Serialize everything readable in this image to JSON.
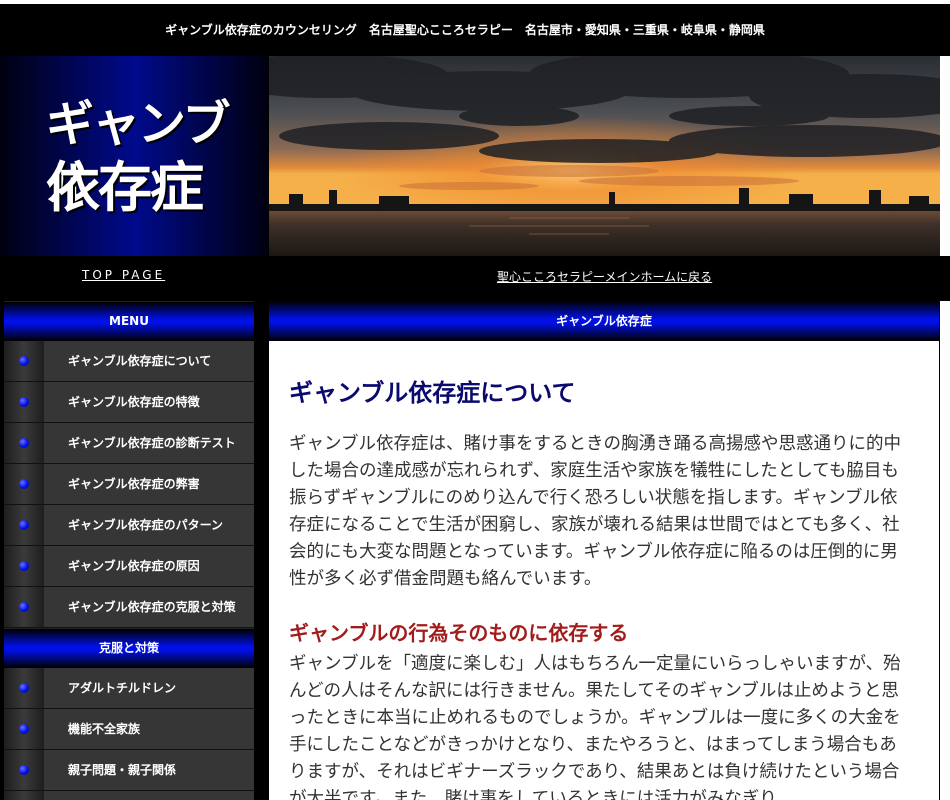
{
  "header": {
    "title": "ギャンブル依存症のカウンセリング　名古屋聖心こころセラピー　名古屋市・愛知県・三重県・岐阜県・静岡県"
  },
  "logo": {
    "line1": "ギャンブル",
    "line2": "依存症"
  },
  "nav": {
    "top_page": "TOP PAGE",
    "main_home": "聖心こころセラピーメインホームに戻る"
  },
  "sidebar": {
    "menu_heading": "MENU",
    "menu_items": [
      {
        "label": "ギャンブル依存症について"
      },
      {
        "label": "ギャンブル依存症の特徴"
      },
      {
        "label": "ギャンブル依存症の診断テスト"
      },
      {
        "label": "ギャンブル依存症の弊害"
      },
      {
        "label": "ギャンブル依存症のパターン"
      },
      {
        "label": "ギャンブル依存症の原因"
      },
      {
        "label": "ギャンブル依存症の克服と対策"
      }
    ],
    "section2_heading": "克服と対策",
    "section2_items": [
      {
        "label": "アダルトチルドレン"
      },
      {
        "label": "機能不全家族"
      },
      {
        "label": "親子問題・親子関係"
      }
    ]
  },
  "main": {
    "heading_bar": "ギャンブル依存症",
    "h1": "ギャンブル依存症について",
    "p1": "ギャンブル依存症は、賭け事をするときの胸湧き踊る高揚感や思惑通りに的中した場合の達成感が忘れられず、家庭生活や家族を犠牲にしたとしても脇目も振らずギャンブルにのめり込んで行く恐ろしい状態を指します。ギャンブル依存症になることで生活が困窮し、家族が壊れる結果は世間ではとても多く、社会的にも大変な問題となっています。ギャンブル依存症に陥るのは圧倒的に男性が多く必ず借金問題も絡んでいます。",
    "h2": "ギャンブルの行為そのものに依存する",
    "p2": "ギャンブルを「適度に楽しむ」人はもちろん一定量にいらっしゃいますが、殆んどの人はそんな訳には行きません。果たしてそのギャンブルは止めようと思ったときに本当に止めれるものでしょうか。ギャンブルは一度に多くの大金を手にしたことなどがきっかけとなり、またやろうと、はまってしまう場合もありますが、それはビギナーズラックであり、結果あとは負け続けたという場合が大半です。また、賭け事をしているときには活力がみなぎり、"
  }
}
